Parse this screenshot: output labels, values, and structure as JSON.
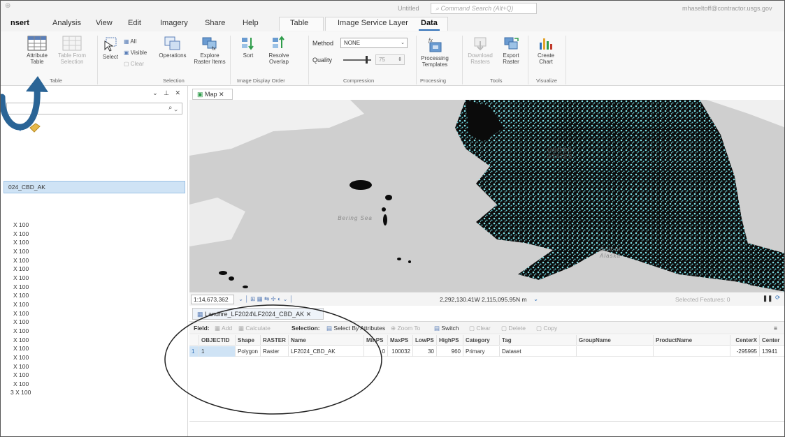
{
  "titlebar": {
    "quick_access": "⊕",
    "doc_title": "Untitled",
    "command_search": "Command Search (Alt+Q)",
    "user": "mhaseltoff@contractor.usgs.gov"
  },
  "tabs": [
    {
      "label": "nsert"
    },
    {
      "label": "Analysis"
    },
    {
      "label": "View"
    },
    {
      "label": "Edit"
    },
    {
      "label": "Imagery"
    },
    {
      "label": "Share"
    },
    {
      "label": "Help"
    },
    {
      "label": "Table"
    },
    {
      "label": "Image Service Layer"
    },
    {
      "label": "Data"
    }
  ],
  "ribbon": {
    "table_group": {
      "attribute_table": "Attribute Table",
      "table_from_selection": "Table From Selection",
      "label": "Table"
    },
    "selection_group": {
      "select": "Select",
      "all": "All",
      "visible": "Visible",
      "clear": "Clear",
      "operations": "Operations",
      "explore_raster_items": "Explore Raster Items",
      "label": "Selection"
    },
    "display_order_group": {
      "sort": "Sort",
      "resolve_overlap": "Resolve Overlap",
      "label": "Image Display Order"
    },
    "compression_group": {
      "method_label": "Method",
      "method_value": "NONE",
      "quality_label": "Quality",
      "quality_value": "75",
      "label": "Compression"
    },
    "processing_group": {
      "processing_templates": "Processing Templates",
      "label": "Processing"
    },
    "tools_group": {
      "download_rasters": "Download Rasters",
      "export_raster": "Export Raster",
      "label": "Tools"
    },
    "visualize_group": {
      "create_chart": "Create Chart",
      "label": "Visualize"
    }
  },
  "contents": {
    "pane_controls": "⌄ ⊥ ✕",
    "selected_layer": "024_CBD_AK",
    "resolution_items": [
      "X 100",
      "X 100",
      "X 100",
      "X 100",
      "X 100",
      "X 100",
      "X 100",
      "X 100",
      "X 100",
      "X 100",
      "X 100",
      "X 100",
      "X 100",
      "X 100",
      "X 100",
      "X 100",
      "X 100",
      "X 100",
      "X 100",
      "3 X 100"
    ]
  },
  "map": {
    "tab_label": "Map",
    "labels": {
      "bering": "Bering Sea",
      "gulf": "Gulf of Alaska",
      "state": "UNITED STATES"
    },
    "scale": "1:14,673,362",
    "coordinates": "2,292,130.41W 2,115,095.95N m",
    "selected_features": "Selected Features: 0"
  },
  "attribute_table": {
    "tab_label": "Landfire_LF2024\\LF2024_CBD_AK",
    "toolbar": {
      "field": "Field:",
      "add": "Add",
      "calculate": "Calculate",
      "selection": "Selection:",
      "select_by_attributes": "Select By Attributes",
      "zoom_to": "Zoom To",
      "switch": "Switch",
      "clear": "Clear",
      "delete": "Delete",
      "copy": "Copy"
    },
    "columns": [
      "OBJECTID",
      "Shape",
      "RASTER",
      "Name",
      "MinPS",
      "MaxPS",
      "LowPS",
      "HighPS",
      "Category",
      "Tag",
      "GroupName",
      "ProductName",
      "CenterX",
      "Center"
    ],
    "rows": [
      {
        "row_num": "1",
        "OBJECTID": "1",
        "Shape": "Polygon",
        "RASTER": "Raster",
        "Name": "LF2024_CBD_AK",
        "MinPS": "0",
        "MaxPS": "100032",
        "LowPS": "30",
        "HighPS": "960",
        "Category": "Primary",
        "Tag": "Dataset",
        "GroupName": "",
        "ProductName": "",
        "CenterX": "-295995",
        "CenterY": "13941"
      }
    ]
  },
  "colors": {
    "accent": "#2e6fb8",
    "selection_fill": "#cfe3f5",
    "land_dark": "#0b0b0b",
    "cyan_raster": "#7fe0e6",
    "annotation_arrow": "#2a6496"
  }
}
